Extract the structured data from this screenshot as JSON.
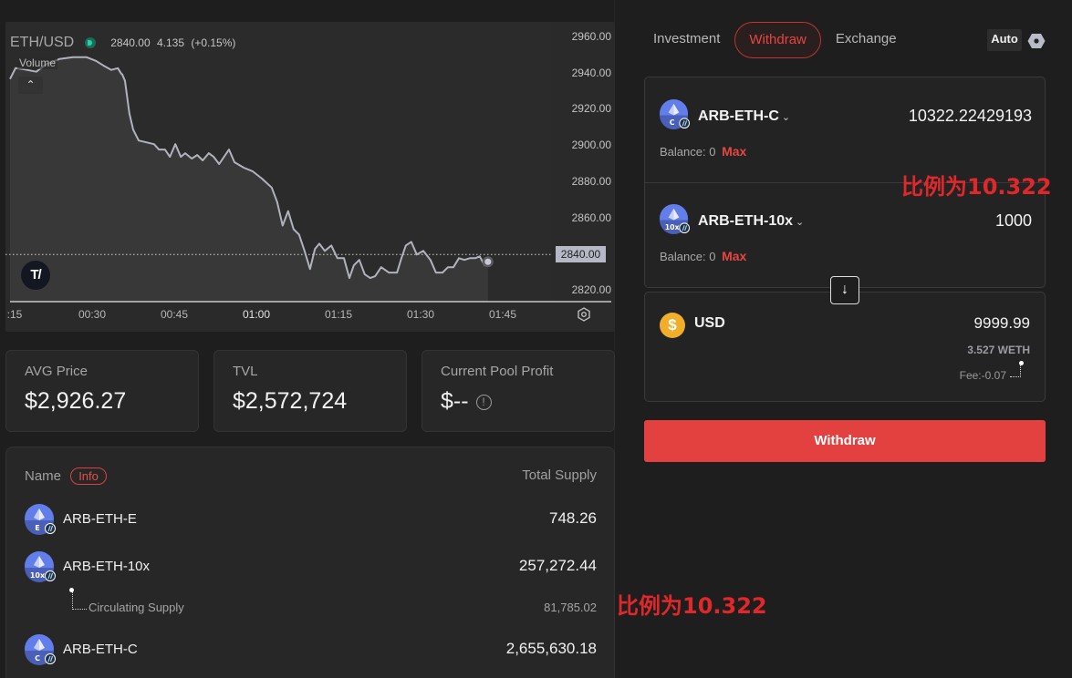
{
  "chart": {
    "symbol": "ETH/USD",
    "last_price": "2840.00",
    "change": "4.135",
    "change_pct": "(+0.15%)",
    "volume_label": "Volume",
    "collapse_icon": "chevron-up-icon",
    "logo": "TradingView",
    "price_badge": "2840.00",
    "settings_icon": "gear-icon"
  },
  "chart_data": {
    "type": "area",
    "title": "ETH/USD",
    "x_unit": "minutes since 00:00",
    "x": [
      15,
      16,
      17.3,
      19.8,
      21.5,
      24,
      26.5,
      29,
      30.7,
      32.3,
      33.5,
      34.7,
      35.3,
      35.5,
      36,
      36.8,
      37.5,
      38.5,
      41.3,
      42.2,
      43.3,
      44.2,
      45.2,
      46.2,
      47,
      48.2,
      49.2,
      50.2,
      51.3,
      52.2,
      53.2,
      55,
      56,
      57.7,
      59.3,
      61,
      62.8,
      63.8,
      64.8,
      65.8,
      66.8,
      67.8,
      68.8,
      69.8,
      70.7,
      71.5,
      72.5,
      73.7,
      74.8,
      76,
      77,
      77.8,
      78.8,
      79.8,
      80.8,
      81.7,
      82.8,
      84.2,
      85.7,
      86.5,
      87.3,
      88.3,
      89.3,
      90.5,
      91.8,
      92.8,
      94,
      95,
      96,
      97,
      98,
      99,
      100,
      100.8,
      101.7,
      102.3
    ],
    "y": [
      2937,
      2943,
      2942.5,
      2941,
      2945,
      2948,
      2949,
      2949,
      2947,
      2944,
      2942,
      2943,
      2940,
      2939.5,
      2936,
      2918,
      2909,
      2903,
      2901,
      2898,
      2898,
      2894,
      2901,
      2894,
      2896,
      2893,
      2895,
      2892,
      2896,
      2894,
      2890,
      2898,
      2891,
      2888,
      2886,
      2882,
      2877,
      2869,
      2856,
      2864,
      2854,
      2851,
      2842,
      2832,
      2843,
      2846,
      2842,
      2845,
      2838,
      2838,
      2827,
      2834,
      2837,
      2829,
      2827,
      2828,
      2833,
      2830,
      2830,
      2838,
      2845,
      2847,
      2840,
      2842,
      2837,
      2830,
      2830,
      2833,
      2833,
      2838,
      2837,
      2838,
      2838,
      2839,
      2834,
      2836,
      2840
    ],
    "x_ticks": [
      ":15",
      "00:30",
      "00:45",
      "01:00",
      "01:15",
      "01:30",
      "01:45"
    ],
    "y_ticks": [
      "2960.00",
      "2940.00",
      "2920.00",
      "2900.00",
      "2880.00",
      "2860.00",
      "2840.00",
      "2820.00"
    ],
    "ylim": [
      2815,
      2962
    ],
    "xlim": [
      15,
      125
    ],
    "last_value": 2840.0,
    "legend": "top-left",
    "grid": false
  },
  "stats": [
    {
      "label": "AVG Price",
      "value": "$2,926.27"
    },
    {
      "label": "TVL",
      "value": "$2,572,724"
    },
    {
      "label": "Current Pool Profit",
      "value": "$--",
      "icon": "info-icon"
    }
  ],
  "supply": {
    "name_header": "Name",
    "info_label": "Info",
    "total_header": "Total Supply",
    "rows": [
      {
        "name": "ARB-ETH-E",
        "badge": "E",
        "amount": "748.26"
      },
      {
        "name": "ARB-ETH-10x",
        "badge": "10x",
        "amount": "257,272.44"
      },
      {
        "name": "ARB-ETH-C",
        "badge": "C",
        "amount": "2,655,630.18"
      }
    ],
    "circulating": {
      "label": "Circulating Supply",
      "amount": "81,785.02"
    }
  },
  "tabs": [
    {
      "label": "Investment",
      "active": false
    },
    {
      "label": "Withdraw",
      "active": true
    },
    {
      "label": "Exchange",
      "active": false
    }
  ],
  "auto_label": "Auto",
  "swap": {
    "from": [
      {
        "token": "ARB-ETH-C",
        "badge": "C",
        "amount": "10322.22429193",
        "balance_label": "Balance: 0",
        "max_label": "Max"
      },
      {
        "token": "ARB-ETH-10x",
        "badge": "10x",
        "amount": "1000",
        "balance_label": "Balance: 0",
        "max_label": "Max"
      }
    ],
    "arrow_icon": "arrow-down-icon",
    "to": {
      "token": "USD",
      "amount": "9999.99",
      "weth": "3.527 WETH",
      "fee": "Fee:-0.07"
    },
    "submit_label": "Withdraw"
  },
  "annotations": [
    "比例为10.322",
    "比例为10.322"
  ],
  "colors": {
    "accent": "#e34140",
    "eth_blue": "#627eea",
    "usd_gold": "#f0ae2a"
  }
}
